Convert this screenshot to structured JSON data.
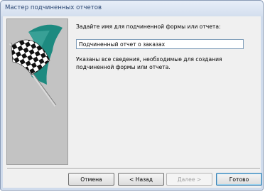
{
  "window": {
    "title": "Мастер подчиненных отчетов"
  },
  "wizard": {
    "prompt": "Задайте имя для подчиненной формы или отчета:",
    "name_value": "Подчиненный отчет о заказах",
    "info": "Указаны все сведения, необходимые для создания подчиненной формы или отчета.",
    "image_icon": "checkered-flag-icon"
  },
  "buttons": {
    "cancel": "Отмена",
    "back": "< Назад",
    "next": "Далее >",
    "finish": "Готово"
  },
  "colors": {
    "accent": "#2f4a75",
    "flag_teal": "#1d8a80",
    "panel_gray": "#c3c3c3"
  }
}
